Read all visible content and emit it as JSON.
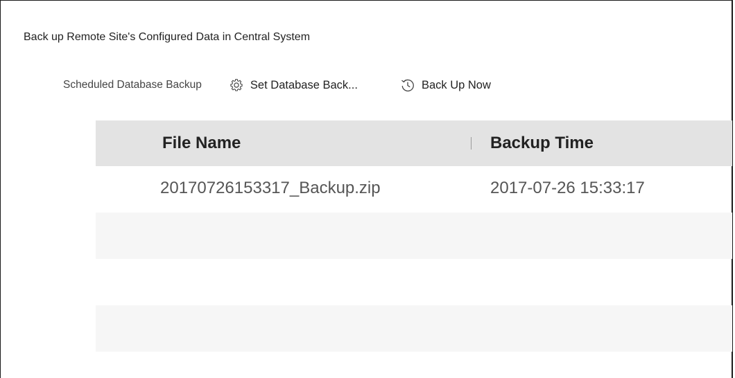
{
  "section": {
    "title": "Back up Remote Site's Configured Data in Central System"
  },
  "toolbar": {
    "label": "Scheduled Database Backup",
    "settings_button": {
      "label": "Set Database Back...",
      "icon": "gear-icon"
    },
    "backup_button": {
      "label": "Back Up Now",
      "icon": "history-icon"
    }
  },
  "table": {
    "columns": [
      "File Name",
      "Backup Time"
    ],
    "rows": [
      {
        "file_name": "20170726153317_Backup.zip",
        "backup_time": "2017-07-26 15:33:17"
      },
      {
        "file_name": "",
        "backup_time": ""
      },
      {
        "file_name": "",
        "backup_time": ""
      },
      {
        "file_name": "",
        "backup_time": ""
      }
    ]
  },
  "colors": {
    "header_bg": "#e3e3e3",
    "alt_row_bg": "#f6f6f6",
    "text_primary": "#222222",
    "text_secondary": "#555555"
  }
}
